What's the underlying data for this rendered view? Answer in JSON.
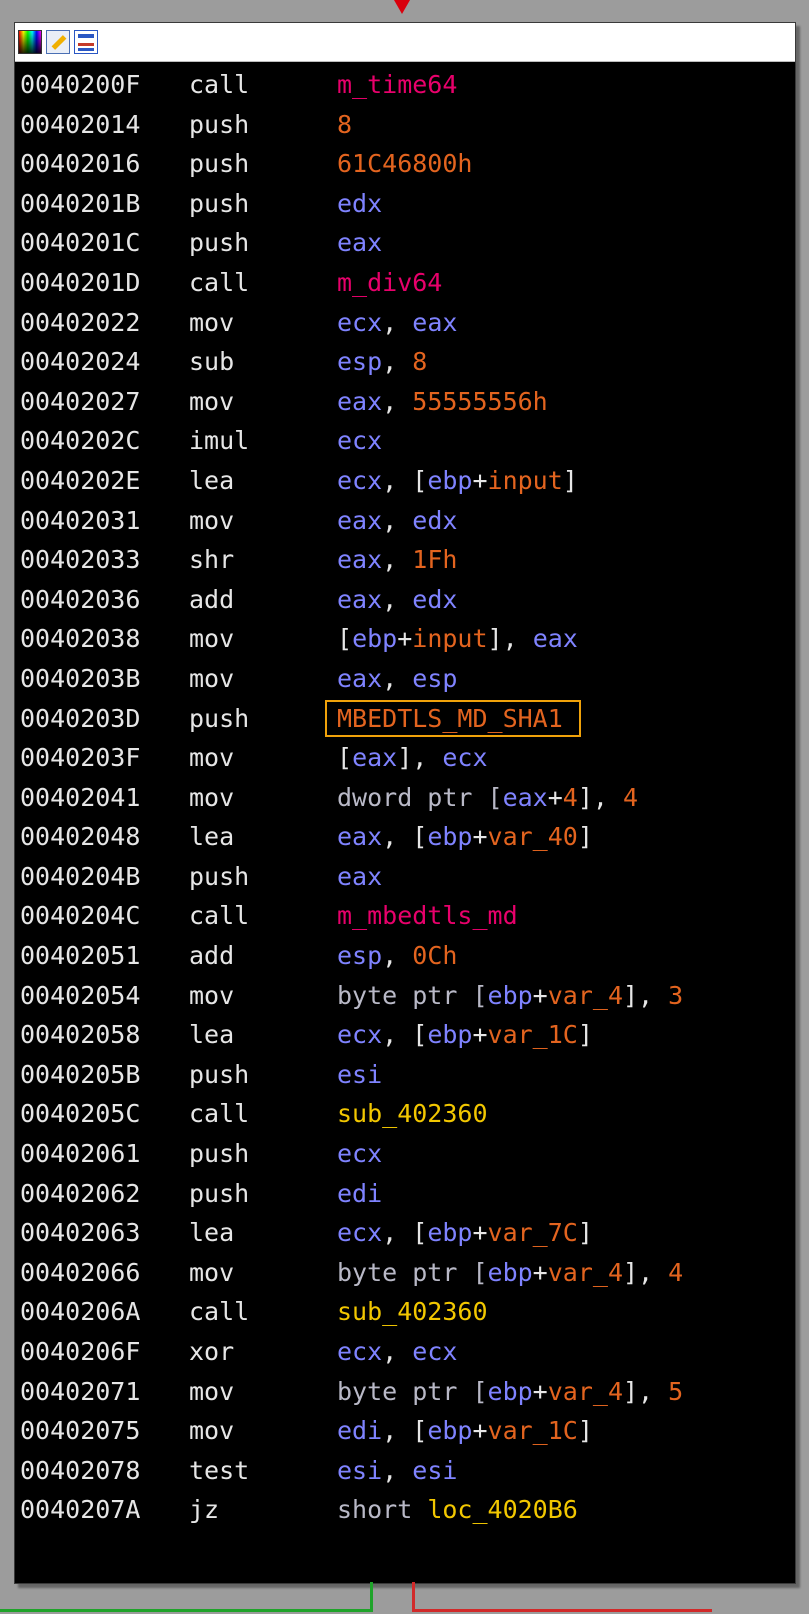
{
  "window": {
    "toolbar_icons": [
      "color-palette-icon",
      "edit-icon",
      "graph-overview-icon"
    ]
  },
  "colors": {
    "register": "#7f83ff",
    "symbol": "#e8006b",
    "number": "#e3641f",
    "subroutine": "#f2c700",
    "highlight": "#f0a20a",
    "true_branch": "#1fa32a",
    "false_branch": "#d12a2a"
  },
  "listing": [
    {
      "addr": "0040200F",
      "mn": "call",
      "ops": [
        {
          "t": "m_time64",
          "k": "sym"
        }
      ]
    },
    {
      "addr": "00402014",
      "mn": "push",
      "ops": [
        {
          "t": "8",
          "k": "num"
        }
      ]
    },
    {
      "addr": "00402016",
      "mn": "push",
      "ops": [
        {
          "t": "61C46800h",
          "k": "num"
        }
      ]
    },
    {
      "addr": "0040201B",
      "mn": "push",
      "ops": [
        {
          "t": "edx",
          "k": "reg"
        }
      ]
    },
    {
      "addr": "0040201C",
      "mn": "push",
      "ops": [
        {
          "t": "eax",
          "k": "reg"
        }
      ]
    },
    {
      "addr": "0040201D",
      "mn": "call",
      "ops": [
        {
          "t": "m_div64",
          "k": "sym"
        }
      ]
    },
    {
      "addr": "00402022",
      "mn": "mov",
      "ops": [
        {
          "t": "ecx",
          "k": "reg"
        },
        {
          "t": ", ",
          "k": "txt"
        },
        {
          "t": "eax",
          "k": "reg"
        }
      ]
    },
    {
      "addr": "00402024",
      "mn": "sub",
      "ops": [
        {
          "t": "esp",
          "k": "reg"
        },
        {
          "t": ", ",
          "k": "txt"
        },
        {
          "t": "8",
          "k": "num"
        }
      ]
    },
    {
      "addr": "00402027",
      "mn": "mov",
      "ops": [
        {
          "t": "eax",
          "k": "reg"
        },
        {
          "t": ", ",
          "k": "txt"
        },
        {
          "t": "55555556h",
          "k": "num"
        }
      ]
    },
    {
      "addr": "0040202C",
      "mn": "imul",
      "ops": [
        {
          "t": "ecx",
          "k": "reg"
        }
      ]
    },
    {
      "addr": "0040202E",
      "mn": "lea",
      "ops": [
        {
          "t": "ecx",
          "k": "reg"
        },
        {
          "t": ", [",
          "k": "txt"
        },
        {
          "t": "ebp",
          "k": "reg"
        },
        {
          "t": "+",
          "k": "txt"
        },
        {
          "t": "input",
          "k": "num"
        },
        {
          "t": "]",
          "k": "txt"
        }
      ]
    },
    {
      "addr": "00402031",
      "mn": "mov",
      "ops": [
        {
          "t": "eax",
          "k": "reg"
        },
        {
          "t": ", ",
          "k": "txt"
        },
        {
          "t": "edx",
          "k": "reg"
        }
      ]
    },
    {
      "addr": "00402033",
      "mn": "shr",
      "ops": [
        {
          "t": "eax",
          "k": "reg"
        },
        {
          "t": ", ",
          "k": "txt"
        },
        {
          "t": "1Fh",
          "k": "num"
        }
      ]
    },
    {
      "addr": "00402036",
      "mn": "add",
      "ops": [
        {
          "t": "eax",
          "k": "reg"
        },
        {
          "t": ", ",
          "k": "txt"
        },
        {
          "t": "edx",
          "k": "reg"
        }
      ]
    },
    {
      "addr": "00402038",
      "mn": "mov",
      "ops": [
        {
          "t": "[",
          "k": "txt"
        },
        {
          "t": "ebp",
          "k": "reg"
        },
        {
          "t": "+",
          "k": "txt"
        },
        {
          "t": "input",
          "k": "num"
        },
        {
          "t": "], ",
          "k": "txt"
        },
        {
          "t": "eax",
          "k": "reg"
        }
      ]
    },
    {
      "addr": "0040203B",
      "mn": "mov",
      "ops": [
        {
          "t": "eax",
          "k": "reg"
        },
        {
          "t": ", ",
          "k": "txt"
        },
        {
          "t": "esp",
          "k": "reg"
        }
      ]
    },
    {
      "addr": "0040203D",
      "mn": "push",
      "ops": [
        {
          "t": "MBEDTLS_MD_SHA1",
          "k": "num"
        }
      ],
      "highlight": true
    },
    {
      "addr": "0040203F",
      "mn": "mov",
      "ops": [
        {
          "t": "[",
          "k": "txt"
        },
        {
          "t": "eax",
          "k": "reg"
        },
        {
          "t": "], ",
          "k": "txt"
        },
        {
          "t": "ecx",
          "k": "reg"
        }
      ]
    },
    {
      "addr": "00402041",
      "mn": "mov",
      "ops": [
        {
          "t": "dword ptr [",
          "k": "ptr"
        },
        {
          "t": "eax",
          "k": "reg"
        },
        {
          "t": "+",
          "k": "txt"
        },
        {
          "t": "4",
          "k": "num"
        },
        {
          "t": "], ",
          "k": "txt"
        },
        {
          "t": "4",
          "k": "num"
        }
      ]
    },
    {
      "addr": "00402048",
      "mn": "lea",
      "ops": [
        {
          "t": "eax",
          "k": "reg"
        },
        {
          "t": ", [",
          "k": "txt"
        },
        {
          "t": "ebp",
          "k": "reg"
        },
        {
          "t": "+",
          "k": "txt"
        },
        {
          "t": "var_40",
          "k": "num"
        },
        {
          "t": "]",
          "k": "txt"
        }
      ]
    },
    {
      "addr": "0040204B",
      "mn": "push",
      "ops": [
        {
          "t": "eax",
          "k": "reg"
        }
      ]
    },
    {
      "addr": "0040204C",
      "mn": "call",
      "ops": [
        {
          "t": "m_mbedtls_md",
          "k": "sym"
        }
      ]
    },
    {
      "addr": "00402051",
      "mn": "add",
      "ops": [
        {
          "t": "esp",
          "k": "reg"
        },
        {
          "t": ", ",
          "k": "txt"
        },
        {
          "t": "0Ch",
          "k": "num"
        }
      ]
    },
    {
      "addr": "00402054",
      "mn": "mov",
      "ops": [
        {
          "t": "byte ptr [",
          "k": "ptr"
        },
        {
          "t": "ebp",
          "k": "reg"
        },
        {
          "t": "+",
          "k": "txt"
        },
        {
          "t": "var_4",
          "k": "num"
        },
        {
          "t": "], ",
          "k": "txt"
        },
        {
          "t": "3",
          "k": "num"
        }
      ]
    },
    {
      "addr": "00402058",
      "mn": "lea",
      "ops": [
        {
          "t": "ecx",
          "k": "reg"
        },
        {
          "t": ", [",
          "k": "txt"
        },
        {
          "t": "ebp",
          "k": "reg"
        },
        {
          "t": "+",
          "k": "txt"
        },
        {
          "t": "var_1C",
          "k": "num"
        },
        {
          "t": "]",
          "k": "txt"
        }
      ]
    },
    {
      "addr": "0040205B",
      "mn": "push",
      "ops": [
        {
          "t": "esi",
          "k": "reg"
        }
      ]
    },
    {
      "addr": "0040205C",
      "mn": "call",
      "ops": [
        {
          "t": "sub_402360",
          "k": "sub"
        }
      ]
    },
    {
      "addr": "00402061",
      "mn": "push",
      "ops": [
        {
          "t": "ecx",
          "k": "reg"
        }
      ]
    },
    {
      "addr": "00402062",
      "mn": "push",
      "ops": [
        {
          "t": "edi",
          "k": "reg"
        }
      ]
    },
    {
      "addr": "00402063",
      "mn": "lea",
      "ops": [
        {
          "t": "ecx",
          "k": "reg"
        },
        {
          "t": ", [",
          "k": "txt"
        },
        {
          "t": "ebp",
          "k": "reg"
        },
        {
          "t": "+",
          "k": "txt"
        },
        {
          "t": "var_7C",
          "k": "num"
        },
        {
          "t": "]",
          "k": "txt"
        }
      ]
    },
    {
      "addr": "00402066",
      "mn": "mov",
      "ops": [
        {
          "t": "byte ptr [",
          "k": "ptr"
        },
        {
          "t": "ebp",
          "k": "reg"
        },
        {
          "t": "+",
          "k": "txt"
        },
        {
          "t": "var_4",
          "k": "num"
        },
        {
          "t": "], ",
          "k": "txt"
        },
        {
          "t": "4",
          "k": "num"
        }
      ]
    },
    {
      "addr": "0040206A",
      "mn": "call",
      "ops": [
        {
          "t": "sub_402360",
          "k": "sub"
        }
      ]
    },
    {
      "addr": "0040206F",
      "mn": "xor",
      "ops": [
        {
          "t": "ecx",
          "k": "reg"
        },
        {
          "t": ", ",
          "k": "txt"
        },
        {
          "t": "ecx",
          "k": "reg"
        }
      ]
    },
    {
      "addr": "00402071",
      "mn": "mov",
      "ops": [
        {
          "t": "byte ptr [",
          "k": "ptr"
        },
        {
          "t": "ebp",
          "k": "reg"
        },
        {
          "t": "+",
          "k": "txt"
        },
        {
          "t": "var_4",
          "k": "num"
        },
        {
          "t": "], ",
          "k": "txt"
        },
        {
          "t": "5",
          "k": "num"
        }
      ]
    },
    {
      "addr": "00402075",
      "mn": "mov",
      "ops": [
        {
          "t": "edi",
          "k": "reg"
        },
        {
          "t": ", [",
          "k": "txt"
        },
        {
          "t": "ebp",
          "k": "reg"
        },
        {
          "t": "+",
          "k": "txt"
        },
        {
          "t": "var_1C",
          "k": "num"
        },
        {
          "t": "]",
          "k": "txt"
        }
      ]
    },
    {
      "addr": "00402078",
      "mn": "test",
      "ops": [
        {
          "t": "esi",
          "k": "reg"
        },
        {
          "t": ", ",
          "k": "txt"
        },
        {
          "t": "esi",
          "k": "reg"
        }
      ]
    },
    {
      "addr": "0040207A",
      "mn": "jz",
      "ops": [
        {
          "t": "short ",
          "k": "ptr"
        },
        {
          "t": "loc_4020B6",
          "k": "sub"
        }
      ]
    }
  ]
}
